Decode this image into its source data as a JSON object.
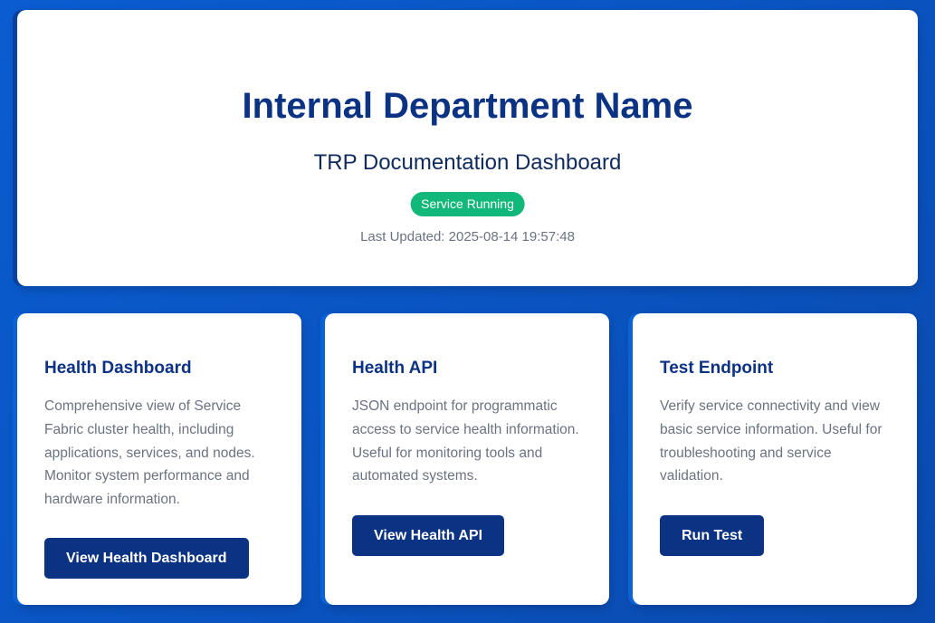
{
  "header": {
    "department_name": "Internal Department Name",
    "subtitle": "TRP Documentation Dashboard",
    "status": "Service Running",
    "last_updated_label": "Last Updated:",
    "last_updated_value": "2025-08-14 19:57:48"
  },
  "cards": [
    {
      "title": "Health Dashboard",
      "description": "Comprehensive view of Service Fabric cluster health, including applications, services, and nodes. Monitor system performance and hardware information.",
      "button_label": "View Health Dashboard"
    },
    {
      "title": "Health API",
      "description": "JSON endpoint for programmatic access to service health information. Useful for monitoring tools and automated systems.",
      "button_label": "View Health API"
    },
    {
      "title": "Test Endpoint",
      "description": "Verify service connectivity and view basic service information. Useful for troubleshooting and service validation.",
      "button_label": "Run Test"
    }
  ],
  "colors": {
    "primary": "#0b3283",
    "status_green": "#12b77a",
    "background_blue": "#0a55c4"
  }
}
